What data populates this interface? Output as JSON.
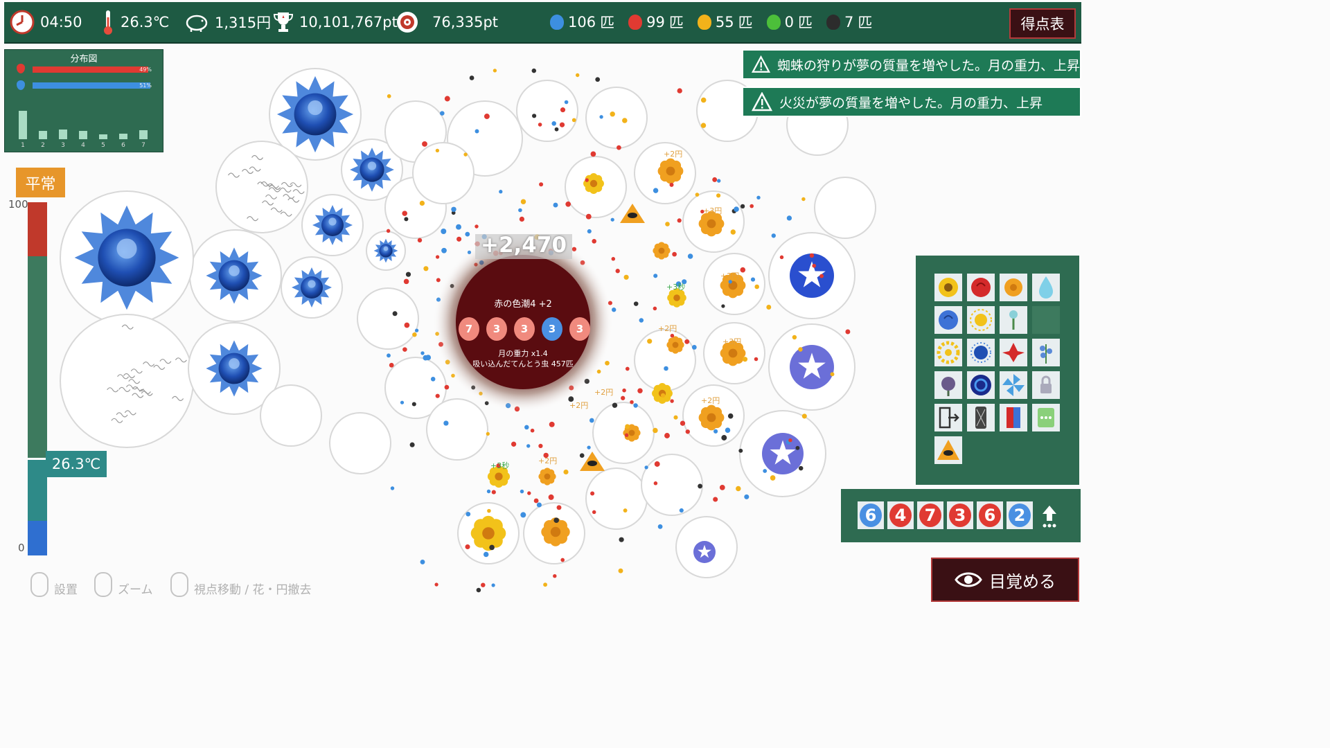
{
  "hud": {
    "time": "04:50",
    "temperature": "26.3℃",
    "money": "1,315円",
    "total_points": "10,101,767pt",
    "target_points": "76,335pt",
    "bug_counts": [
      {
        "color": "#3d8fe0",
        "count": "106",
        "unit": "匹"
      },
      {
        "color": "#e03a32",
        "count": "99",
        "unit": "匹"
      },
      {
        "color": "#f2b21a",
        "count": "55",
        "unit": "匹"
      },
      {
        "color": "#4cbf3a",
        "count": "0",
        "unit": "匹"
      },
      {
        "color": "#2c2c2c",
        "count": "7",
        "unit": "匹"
      }
    ],
    "scoreboard_label": "得点表"
  },
  "distribution": {
    "title": "分布図",
    "red_pct": "49%",
    "blue_pct": "51%",
    "red_fraction": 0.49,
    "blue_fraction": 0.51,
    "histogram_labels": [
      "1",
      "2",
      "3",
      "4",
      "5",
      "6",
      "7"
    ],
    "histogram_values": [
      0.85,
      0.25,
      0.3,
      0.26,
      0.14,
      0.16,
      0.28
    ]
  },
  "status": {
    "mood": "平常",
    "gauge_max": "100",
    "gauge_min": "0",
    "temperature": "26.3℃",
    "temperature_fraction": 0.27
  },
  "notifications": [
    "蜘蛛の狩りが夢の質量を増やした。月の重力、上昇",
    "火災が夢の質量を増やした。月の重力、上昇"
  ],
  "black_hole": {
    "score_popup": "+2,470",
    "tide_label": "赤の色潮4 +2",
    "tide_bugs": [
      {
        "n": "7",
        "color": "#f08a7e"
      },
      {
        "n": "3",
        "color": "#f08a7e"
      },
      {
        "n": "3",
        "color": "#f08a7e"
      },
      {
        "n": "3",
        "color": "#4a90e2"
      },
      {
        "n": "3",
        "color": "#f08a7e"
      }
    ],
    "gravity_label": "月の重力 x1.4",
    "absorbed_label": "吸い込んだてんとう虫 457匹"
  },
  "field_popups": [
    "+2円",
    "+2円",
    "+2円",
    "+2円",
    "+2円",
    "+2円",
    "+2円",
    "+3秒",
    "+3秒",
    "+3円",
    "+3円"
  ],
  "palette": {
    "items": [
      "sunflower-icon",
      "red-rose-icon",
      "marigold-icon",
      "water-drop-icon",
      "blue-rose-icon",
      "sun-icon",
      "hydrangea-sprout-icon",
      "empty-slot",
      "yellow-flower-icon",
      "blue-urchin-icon",
      "red-lily-icon",
      "blue-bell-icon",
      "thistle-icon",
      "galaxy-flower-icon",
      "pinwheel-icon",
      "lock-icon",
      "exit-door-icon",
      "net-icon",
      "color-card-icon",
      "more-icon",
      "eye-pyramid-icon"
    ]
  },
  "queue": {
    "items": [
      {
        "n": "6",
        "color": "#4a90e2"
      },
      {
        "n": "4",
        "color": "#e03a32"
      },
      {
        "n": "7",
        "color": "#e03a32"
      },
      {
        "n": "3",
        "color": "#e03a32"
      },
      {
        "n": "6",
        "color": "#e03a32"
      },
      {
        "n": "2",
        "color": "#4a90e2"
      }
    ]
  },
  "wake_button": "目覚める",
  "controls_hint": {
    "place": "設置",
    "zoom": "ズーム",
    "move": "視点移動 / 花・円撤去"
  }
}
